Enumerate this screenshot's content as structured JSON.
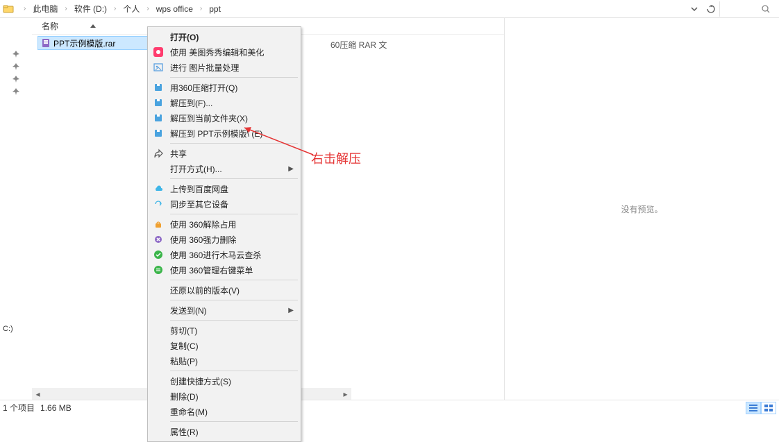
{
  "breadcrumb": {
    "items": [
      "此电脑",
      "软件 (D:)",
      "个人",
      "wps office",
      "ppt"
    ]
  },
  "columns": {
    "name": "名称"
  },
  "file": {
    "name": "PPT示例模版.rar",
    "type_partial": "60压缩 RAR 文"
  },
  "drive_label": "C:)",
  "preview_text": "没有预览。",
  "annotation_text": "右击解压",
  "status": {
    "count": "1 个项目",
    "size": "1.66 MB"
  },
  "context_menu": {
    "groups": [
      [
        {
          "icon": "",
          "label": "打开(O)",
          "bold": true
        },
        {
          "icon": "meitu",
          "label": "使用 美图秀秀编辑和美化"
        },
        {
          "icon": "image",
          "label": "进行 图片批量处理"
        }
      ],
      [
        {
          "icon": "archive",
          "label": "用360压缩打开(Q)"
        },
        {
          "icon": "archive",
          "label": "解压到(F)..."
        },
        {
          "icon": "archive",
          "label": "解压到当前文件夹(X)"
        },
        {
          "icon": "archive",
          "label": "解压到 PPT示例模版\\ (E)"
        }
      ],
      [
        {
          "icon": "share",
          "label": "共享"
        },
        {
          "icon": "",
          "label": "打开方式(H)...",
          "submenu": true
        }
      ],
      [
        {
          "icon": "cloud",
          "label": "上传到百度网盘"
        },
        {
          "icon": "sync",
          "label": "同步至其它设备"
        }
      ],
      [
        {
          "icon": "lock360",
          "label": "使用 360解除占用"
        },
        {
          "icon": "del360",
          "label": "使用 360强力删除"
        },
        {
          "icon": "scan360",
          "label": "使用 360进行木马云查杀"
        },
        {
          "icon": "menu360",
          "label": "使用 360管理右键菜单"
        }
      ],
      [
        {
          "icon": "",
          "label": "还原以前的版本(V)"
        }
      ],
      [
        {
          "icon": "",
          "label": "发送到(N)",
          "submenu": true
        }
      ],
      [
        {
          "icon": "",
          "label": "剪切(T)"
        },
        {
          "icon": "",
          "label": "复制(C)"
        },
        {
          "icon": "",
          "label": "粘贴(P)"
        }
      ],
      [
        {
          "icon": "",
          "label": "创建快捷方式(S)"
        },
        {
          "icon": "",
          "label": "删除(D)"
        },
        {
          "icon": "",
          "label": "重命名(M)"
        }
      ],
      [
        {
          "icon": "",
          "label": "属性(R)"
        }
      ]
    ]
  }
}
